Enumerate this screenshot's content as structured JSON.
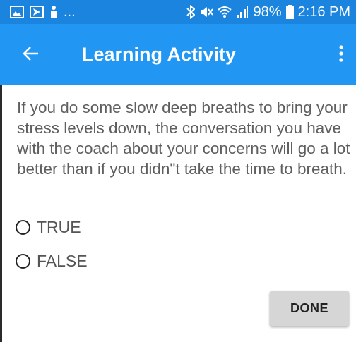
{
  "status_bar": {
    "battery_text": "98%",
    "time": "2:16 PM",
    "overflow_text": "...",
    "icons": [
      "image-icon",
      "send-icon",
      "person-icon",
      "bluetooth-icon",
      "mute-icon",
      "wifi-icon",
      "signal-icon",
      "battery-icon"
    ],
    "background": "#1a84de"
  },
  "app_bar": {
    "title": "Learning Activity",
    "back_icon": "arrow-left-icon",
    "menu_icon": "more-vertical-icon",
    "background": "#2196f3"
  },
  "question": {
    "text": "If you do some slow deep breaths to bring your stress levels down, the conversation you have with the coach about your concerns will go a lot better than if you didn\"t take the time to breath."
  },
  "options": [
    {
      "label": "TRUE",
      "selected": false
    },
    {
      "label": "FALSE",
      "selected": false
    }
  ],
  "done_button": {
    "label": "DONE"
  }
}
